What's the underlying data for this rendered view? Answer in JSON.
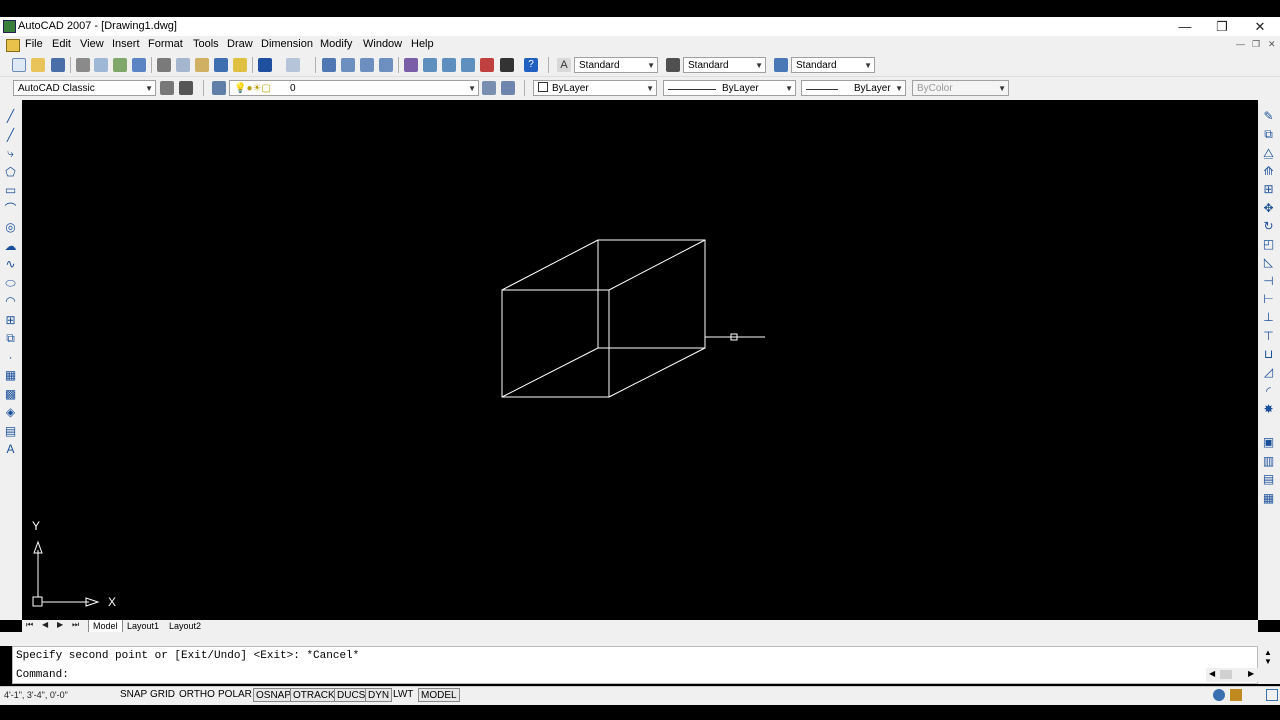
{
  "window": {
    "title": "AutoCAD 2007 - [Drawing1.dwg]",
    "min": "—",
    "max": "❐",
    "close": "✕"
  },
  "menu": [
    "File",
    "Edit",
    "View",
    "Insert",
    "Format",
    "Tools",
    "Draw",
    "Dimension",
    "Modify",
    "Window",
    "Help"
  ],
  "toolbar": {
    "text_style": "Standard",
    "dim_style": "Standard",
    "table_style": "Standard",
    "workspace": "AutoCAD Classic",
    "layer": "0",
    "color": "ByLayer",
    "linetype": "ByLayer",
    "lineweight": "ByLayer",
    "plotstyle": "ByColor"
  },
  "canvas": {
    "ucs_x": "X",
    "ucs_y": "Y"
  },
  "tabs": [
    "Model",
    "Layout1",
    "Layout2"
  ],
  "command": {
    "history": "Specify second point or [Exit/Undo] <Exit>: *Cancel*",
    "prompt": "Command:"
  },
  "status": {
    "coords": "4'-1\", 3'-4\", 0'-0\"",
    "buttons": [
      "SNAP",
      "GRID",
      "ORTHO",
      "POLAR",
      "OSNAP",
      "OTRACK",
      "DUCS",
      "DYN",
      "LWT",
      "MODEL"
    ],
    "on": [
      "OSNAP",
      "OTRACK",
      "DUCS",
      "DYN",
      "MODEL"
    ]
  },
  "left_icons": [
    "line-icon",
    "construction-line-icon",
    "polyline-icon",
    "polygon-icon",
    "rectangle-icon",
    "arc-icon",
    "circle-icon",
    "revision-cloud-icon",
    "spline-icon",
    "ellipse-icon",
    "ellipse-arc-icon",
    "insert-block-icon",
    "make-block-icon",
    "point-icon",
    "hatch-icon",
    "gradient-icon",
    "region-icon",
    "table-icon",
    "multiline-text-icon"
  ],
  "right_icons": [
    "erase-icon",
    "copy-icon",
    "mirror-icon",
    "offset-icon",
    "array-icon",
    "move-icon",
    "rotate-icon",
    "scale-icon",
    "stretch-icon",
    "trim-icon",
    "extend-icon",
    "break-at-point-icon",
    "break-icon",
    "join-icon",
    "chamfer-icon",
    "fillet-icon",
    "explode-icon",
    "draworder-front-icon",
    "draworder-back-icon",
    "draworder-above-icon",
    "draworder-under-icon"
  ]
}
